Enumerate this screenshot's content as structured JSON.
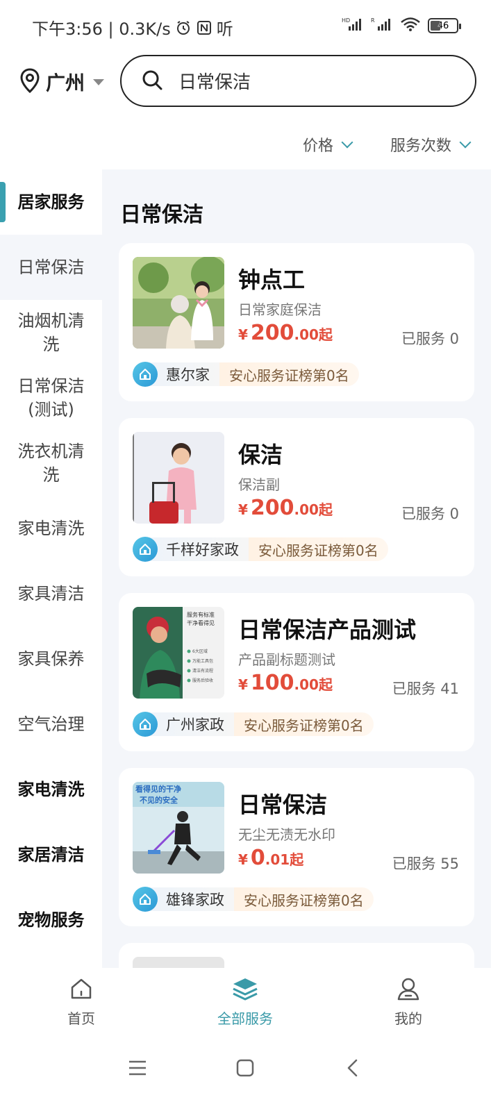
{
  "status_bar": {
    "time_speed": "下午3:56 | 0.3K/s",
    "extra_text": "听",
    "battery_level": "46"
  },
  "header": {
    "city": "广州",
    "search_text": "日常保洁"
  },
  "filters": [
    {
      "label": "价格"
    },
    {
      "label": "服务次数"
    }
  ],
  "sidebar": {
    "items": [
      {
        "label": "居家服务"
      },
      {
        "label": "日常保洁"
      },
      {
        "label": "油烟机清洗"
      },
      {
        "label": "日常保洁(测试)"
      },
      {
        "label": "洗衣机清洗"
      },
      {
        "label": "家电清洗"
      },
      {
        "label": "家具清洁"
      },
      {
        "label": "家具保养"
      },
      {
        "label": "空气治理"
      },
      {
        "label": "家电清洗"
      },
      {
        "label": "家居清洁"
      },
      {
        "label": "宠物服务"
      }
    ]
  },
  "content": {
    "title": "日常保洁",
    "cards": [
      {
        "name": "钟点工",
        "subtitle": "日常家庭保洁",
        "yen": "¥",
        "price_int": "200",
        "price_dec": ".00起",
        "served": "已服务 0",
        "shop": "惠尔家",
        "rank": "安心服务证榜第0名"
      },
      {
        "name": "保洁",
        "subtitle": "保洁副",
        "yen": "¥",
        "price_int": "200",
        "price_dec": ".00起",
        "served": "已服务 0",
        "shop": "千样好家政",
        "rank": "安心服务证榜第0名"
      },
      {
        "name": "日常保洁产品测试",
        "subtitle": "产品副标题测试",
        "yen": "¥",
        "price_int": "100",
        "price_dec": ".00起",
        "served": "已服务 41",
        "shop": "广州家政",
        "rank": "安心服务证榜第0名",
        "image_text": [
          "服务有标准",
          "干净看得见",
          "6大区域",
          "万能工具包",
          "清洁有流程",
          "服务后验收"
        ]
      },
      {
        "name": "日常保洁",
        "subtitle": "无尘无渍无水印",
        "yen": "¥",
        "price_int": "0",
        "price_dec": ".01起",
        "served": "已服务 55",
        "shop": "雄锋家政",
        "rank": "安心服务证榜第0名",
        "image_text": [
          "看得见的干净",
          "不见的安全"
        ]
      }
    ]
  },
  "bottom_nav": {
    "items": [
      {
        "label": "首页"
      },
      {
        "label": "全部服务"
      },
      {
        "label": "我的"
      }
    ],
    "active_color": "#3a9aa8"
  },
  "colors": {
    "accent": "#3aa0b0",
    "price": "#e24c3a",
    "content_bg": "#f4f6fa"
  }
}
